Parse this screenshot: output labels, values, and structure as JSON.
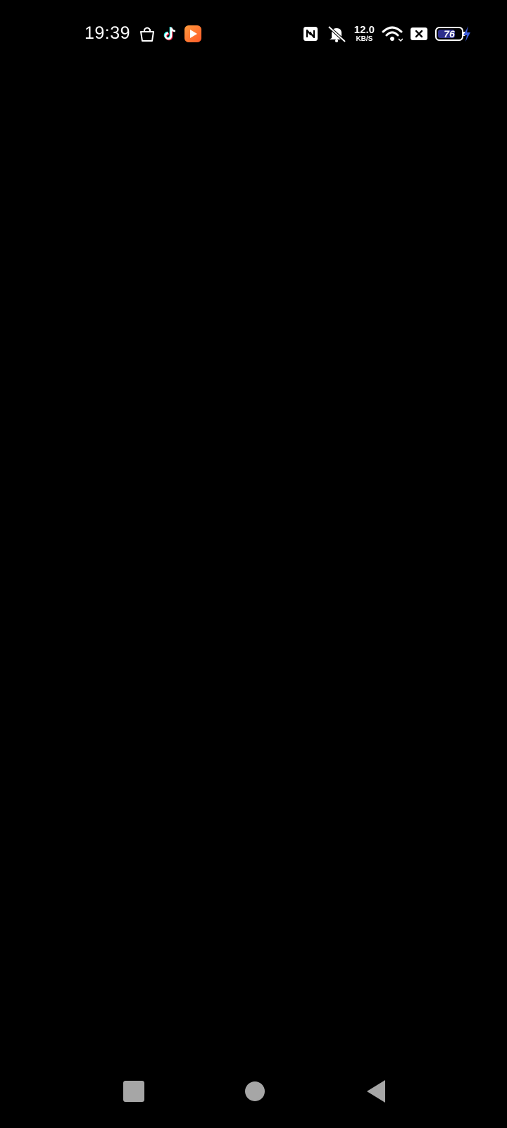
{
  "status_bar": {
    "time": "19:39",
    "notification_icons": [
      "bag-icon",
      "tiktok-icon",
      "video-app-icon"
    ],
    "system_icons": [
      "nfc-icon",
      "mute-icon",
      "wifi-icon",
      "sim-x-icon",
      "battery-icon",
      "charging-icon"
    ],
    "network_speed_value": "12.0",
    "network_speed_unit": "KB/S",
    "battery_level": "76",
    "battery_fraction": 0.76,
    "battery_fill_color": "#2d2f8c",
    "charging_color": "#3b5bd9"
  },
  "main": {
    "background_color": "#000000"
  },
  "nav_bar": {
    "buttons": [
      "recent-apps-button",
      "home-button",
      "back-button"
    ],
    "button_color": "#a6a6a6"
  }
}
